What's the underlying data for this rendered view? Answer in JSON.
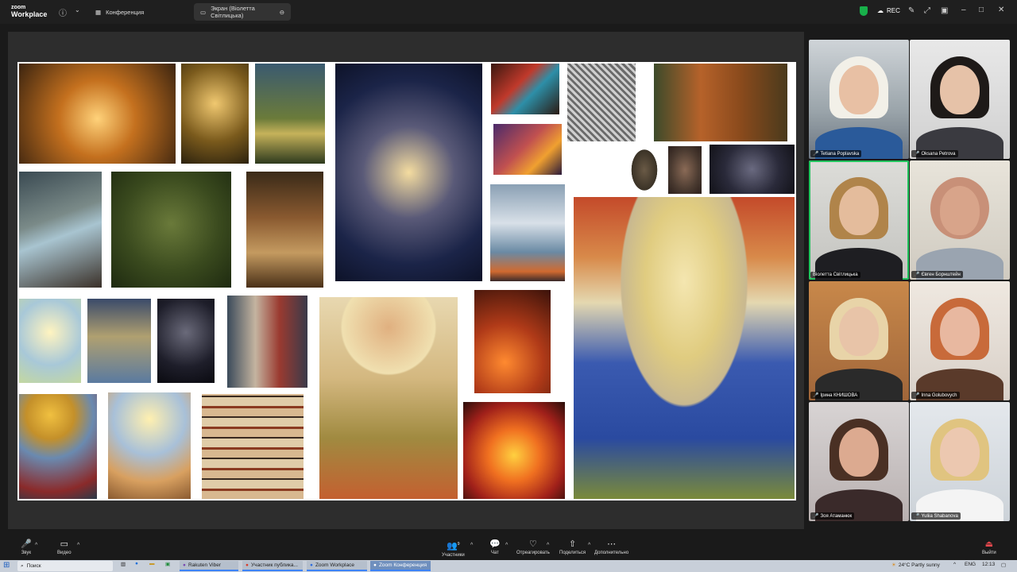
{
  "window": {
    "logo_top": "zoom",
    "logo_bottom": "Workplace",
    "tabs": [
      {
        "label": "Конференция"
      },
      {
        "label": "Экран (Віолетта Світлицька)"
      }
    ],
    "rec_label": "REC"
  },
  "participants": [
    {
      "name": "Tetiana Poplavska",
      "muted": true
    },
    {
      "name": "Oksana Petrova",
      "muted": true
    },
    {
      "name": "Віолетта Світлицька",
      "muted": false
    },
    {
      "name": "Євген Борнштейн",
      "muted": true
    },
    {
      "name": "Ірина КНИШОВА",
      "muted": true
    },
    {
      "name": "Inna Golubovych",
      "muted": true
    },
    {
      "name": "Зоя Атаманюк",
      "muted": true
    },
    {
      "name": "Yuliia Shabanova",
      "muted": true
    }
  ],
  "toolbar": {
    "audio": "Звук",
    "video": "Видео",
    "participants": "Участники",
    "participants_count": "9",
    "chat": "Чат",
    "react": "Отреагировать",
    "share": "Поделиться",
    "more": "Дополнительно",
    "leave": "Выйти"
  },
  "taskbar": {
    "search_placeholder": "Поиск",
    "items": [
      {
        "label": "Rakuten Viber",
        "active": false
      },
      {
        "label": "Участник публика...",
        "active": false
      },
      {
        "label": "Zoom Workplace",
        "active": false
      },
      {
        "label": "Zoom Конференция",
        "active": true
      }
    ],
    "weather": "24°C  Partly sunny",
    "lang": "ENG",
    "time": "12:13"
  },
  "colors": {
    "accent_active_speaker": "#22c55e",
    "leave_red": "#e5484d",
    "security_green": "#18b04a"
  }
}
